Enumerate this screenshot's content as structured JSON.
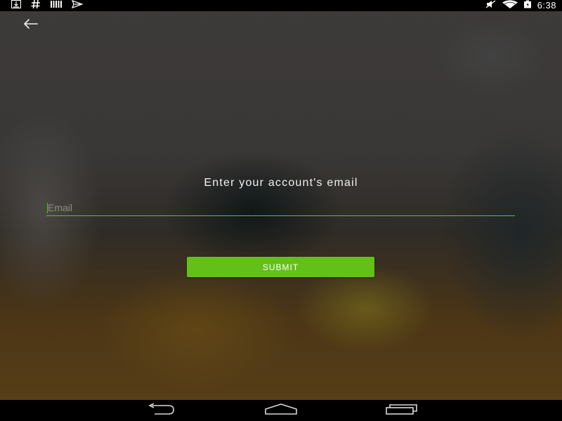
{
  "status_bar": {
    "icons_left": [
      "download-icon",
      "hash-icon",
      "barcode-icon",
      "airplane-icon"
    ],
    "icons_right": [
      "mute-icon",
      "wifi-icon",
      "battery-icon"
    ],
    "time": "6:38"
  },
  "header": {
    "back_icon": "arrow-left-icon"
  },
  "form": {
    "prompt": "Enter your account's email",
    "email_placeholder": "Email",
    "email_value": "",
    "submit_label": "SUBMIT"
  },
  "colors": {
    "accent": "#63c019",
    "underline": "#5fc01e"
  },
  "nav_bar": {
    "icons": [
      "nav-back-icon",
      "nav-home-icon",
      "nav-recents-icon"
    ]
  }
}
